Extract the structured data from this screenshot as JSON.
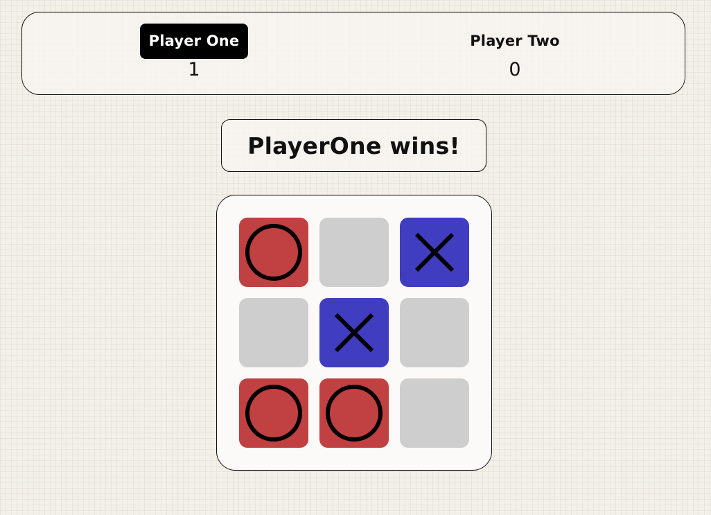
{
  "scoreboard": {
    "players": [
      {
        "name": "Player One",
        "score": "1",
        "active": true
      },
      {
        "name": "Player Two",
        "score": "0",
        "active": false
      }
    ]
  },
  "status": "PlayerOne wins!",
  "board": {
    "cells": [
      "O",
      "",
      "X",
      "",
      "X",
      "",
      "O",
      "O",
      ""
    ]
  },
  "colors": {
    "o_cell": "#c14041",
    "x_cell": "#403dc0",
    "empty_cell": "#cecece",
    "active_player_bg": "#000000"
  },
  "icons": {
    "O": "circle-o-icon",
    "X": "cross-x-icon"
  }
}
